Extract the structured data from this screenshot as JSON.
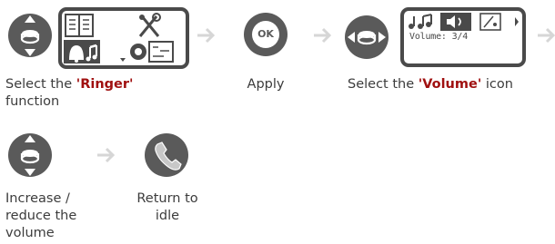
{
  "steps": [
    {
      "text": "Select the ",
      "highlight": "'Ringer'",
      "tail": " function"
    },
    {
      "text": "Apply"
    },
    {
      "text": "Select the ",
      "highlight": "'Volume'",
      "tail": " icon"
    },
    {
      "text": "Increase / reduce the volume"
    },
    {
      "text": "Return to idle"
    }
  ],
  "volume_screen": {
    "readout": "Volume: 3/4"
  },
  "ok_key_label": "OK",
  "colors": {
    "key_dark": "#5a5a5a",
    "key_light": "#c8c8c8",
    "arrow": "#d6d6d6",
    "highlight_text": "#a01010"
  }
}
